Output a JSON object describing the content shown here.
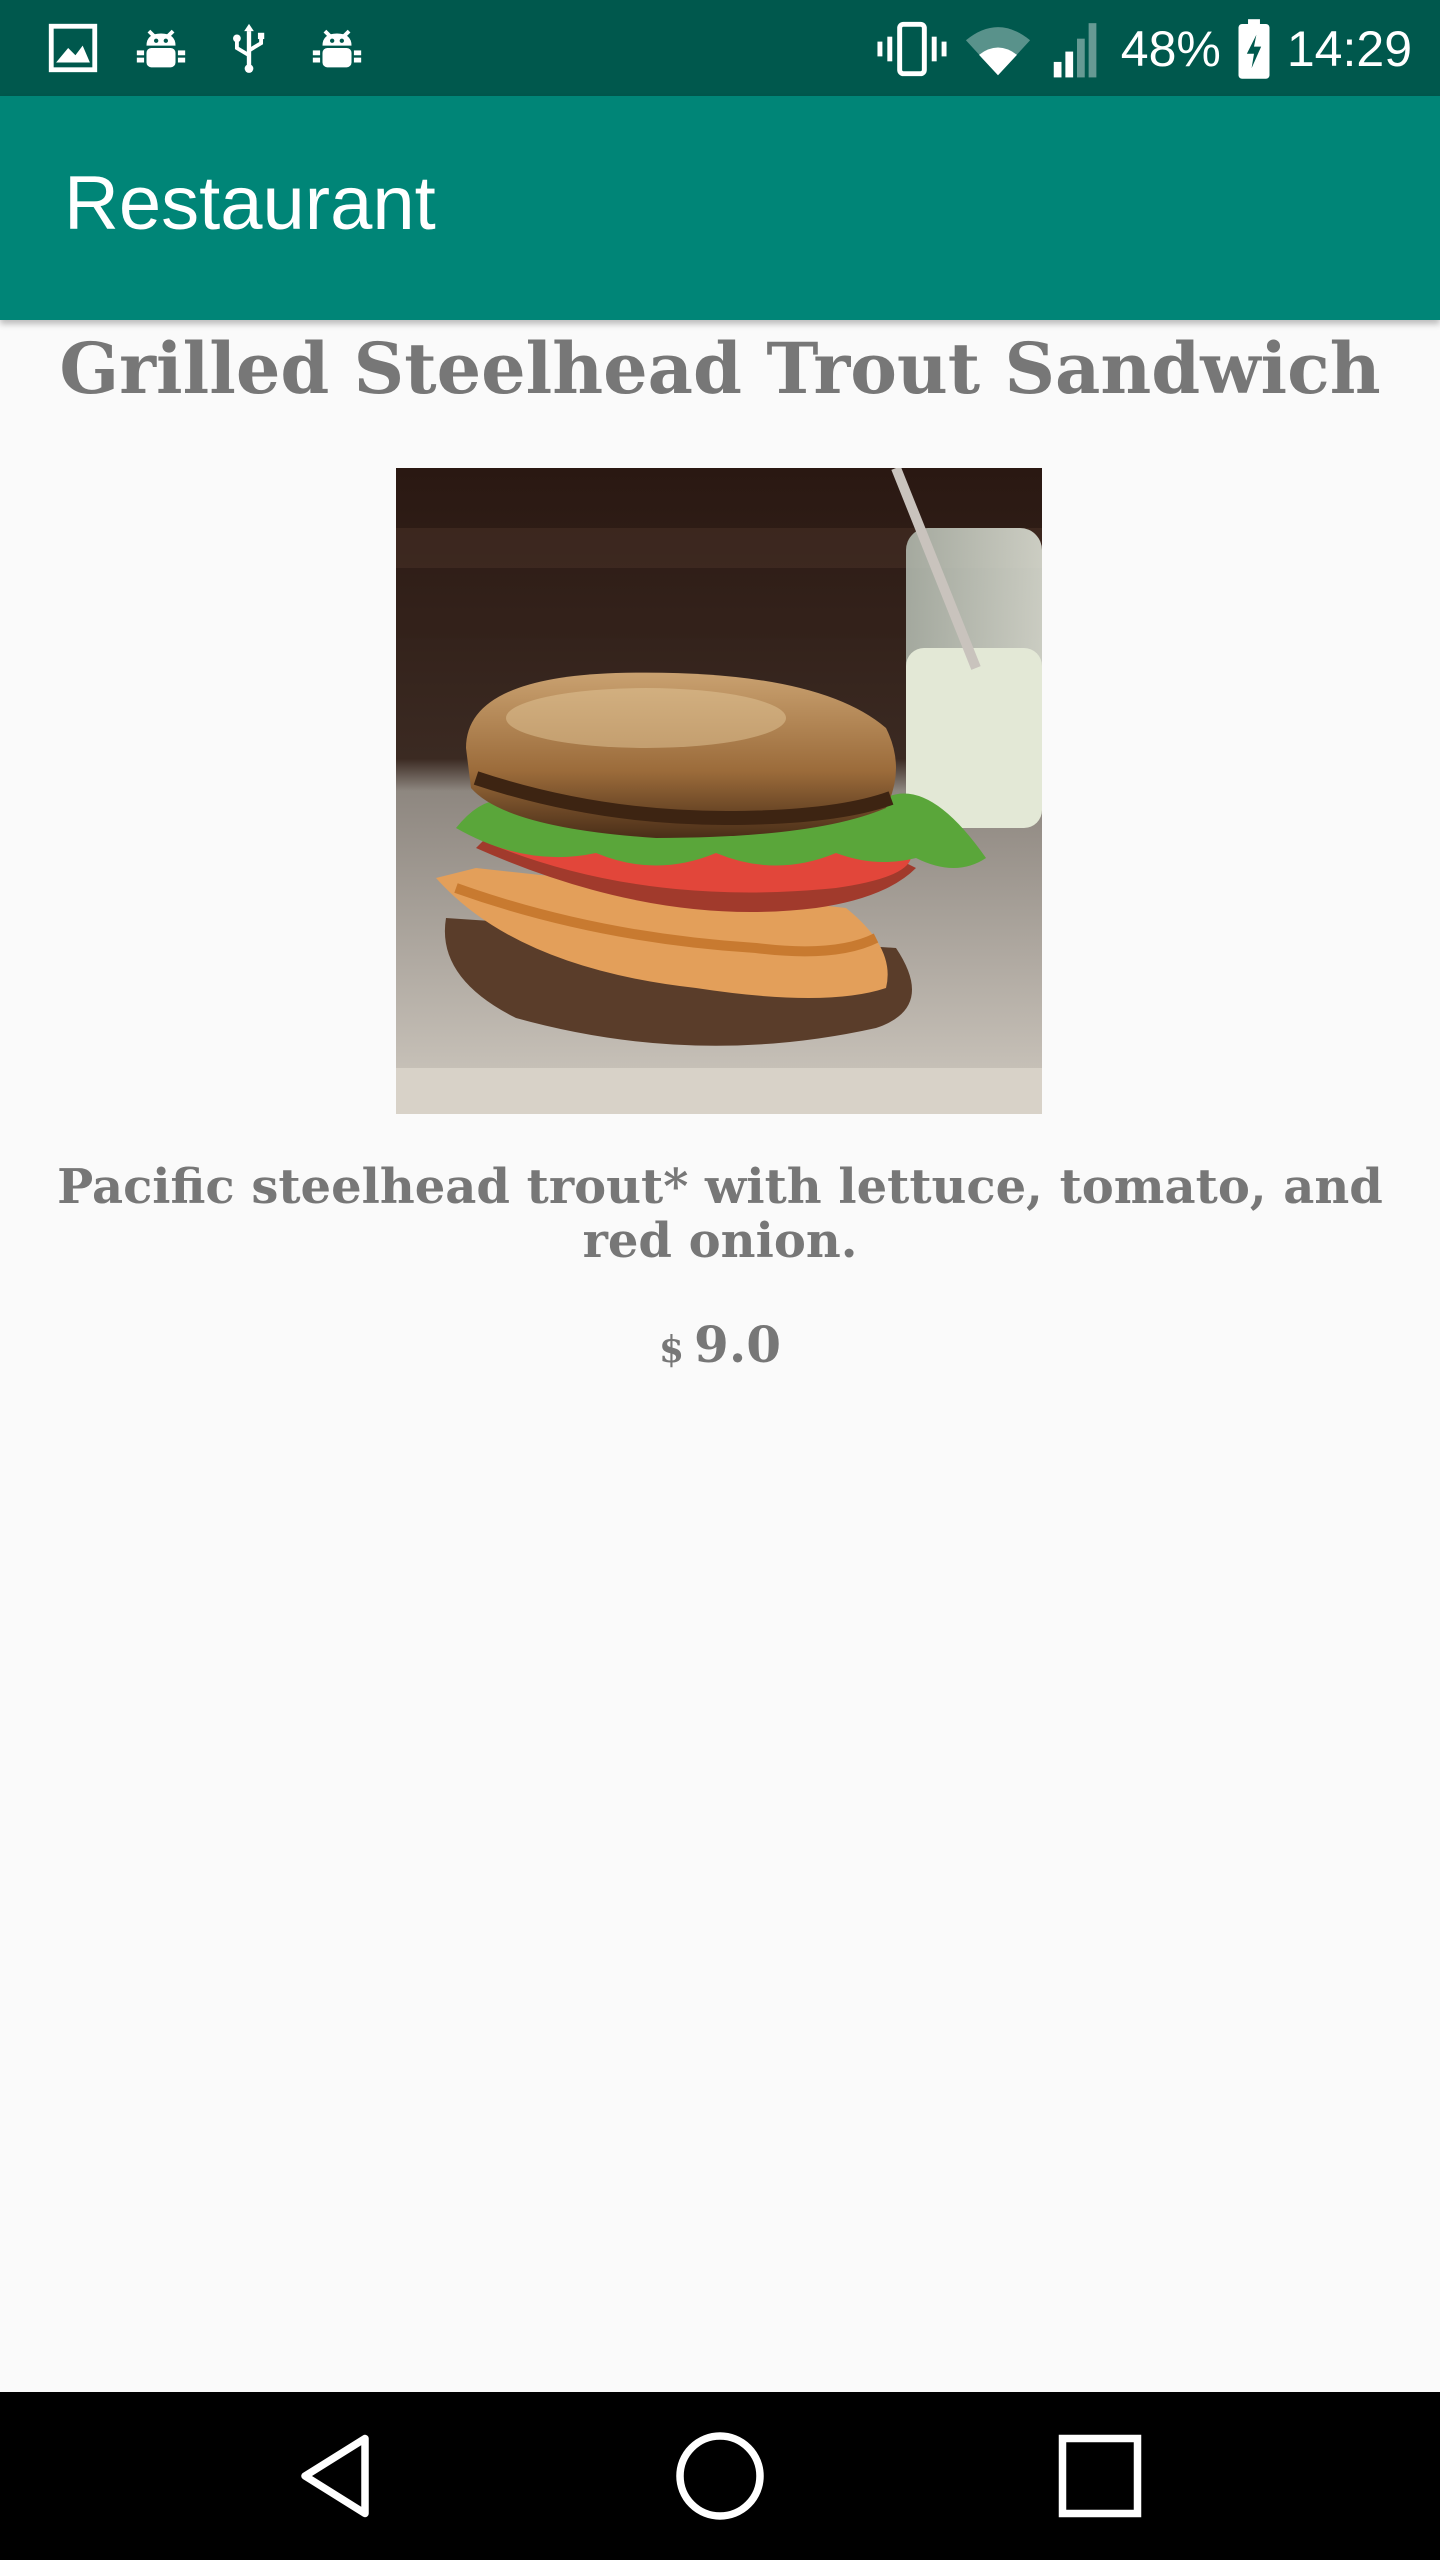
{
  "status_bar": {
    "battery_percent": "48%",
    "time": "14:29",
    "left_icons": [
      "gallery-icon",
      "android-debug-icon",
      "usb-icon",
      "android-debug-icon"
    ],
    "right_icons": [
      "vibrate-icon",
      "wifi-icon",
      "signal-icon",
      "battery-charging-icon"
    ],
    "background_color": "#00584d"
  },
  "app_bar": {
    "title": "Restaurant",
    "background_color": "#008577"
  },
  "dish": {
    "name": "Grilled Steelhead Trout Sandwich",
    "description": "Pacific steelhead trout* with lettuce, tomato, and red onion.",
    "currency_symbol": "$",
    "price": "9.0"
  },
  "navigation_bar": {
    "buttons": [
      "back-icon",
      "home-icon",
      "recent-apps-icon"
    ]
  }
}
